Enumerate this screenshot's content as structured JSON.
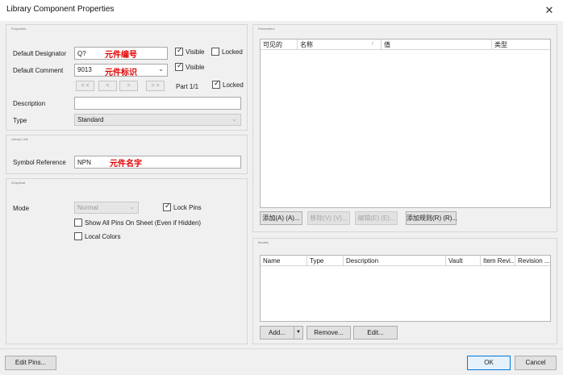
{
  "window": {
    "title": "Library Component Properties",
    "close_glyph": "✕"
  },
  "properties": {
    "section_title": "Properties",
    "default_designator": {
      "label": "Default Designator",
      "value": "Q?",
      "annotation": "元件编号",
      "visible_label": "Visible",
      "locked_label": "Locked"
    },
    "default_comment": {
      "label": "Default Comment",
      "value": "9013",
      "annotation": "元件标识",
      "visible_label": "Visible"
    },
    "part_nav": {
      "first": "< <",
      "prev": "<",
      "next": ">",
      "last": "> >",
      "part_text": "Part 1/1",
      "locked_label": "Locked"
    },
    "description": {
      "label": "Description",
      "value": ""
    },
    "type": {
      "label": "Type",
      "value": "Standard"
    }
  },
  "library_link": {
    "section_title": "Library Link",
    "symbol_reference": {
      "label": "Symbol Reference",
      "value": "NPN",
      "annotation": "元件名字"
    }
  },
  "graphical": {
    "section_title": "Graphical",
    "mode": {
      "label": "Mode",
      "value": "Normal"
    },
    "lock_pins": "Lock Pins",
    "show_all_pins": "Show All Pins On Sheet (Even if Hidden)",
    "local_colors": "Local Colors"
  },
  "parameters": {
    "section_title": "Parameters",
    "columns": [
      "可见的",
      "名称",
      "值",
      "类型"
    ],
    "buttons": {
      "add": "添加(A) (A)...",
      "remove": "移除(V) (V)...",
      "edit": "编辑(E) (E)...",
      "add_rule": "添加规则(R) (R)..."
    }
  },
  "models": {
    "section_title": "Models",
    "columns": [
      "Name",
      "Type",
      "Description",
      "Vault",
      "Item Revi...",
      "Revision ..."
    ],
    "buttons": {
      "add": "Add...",
      "remove": "Remove...",
      "edit": "Edit..."
    }
  },
  "footer": {
    "edit_pins": "Edit Pins...",
    "ok": "OK",
    "cancel": "Cancel"
  },
  "icons": {
    "dropdown": "chevron-down-icon",
    "sort": "sort-indicator-icon",
    "split": "split-dropdown-icon",
    "close": "close-icon",
    "check": "check-icon"
  },
  "colors": {
    "annotation": "#e00000",
    "accent": "#0078d7"
  }
}
